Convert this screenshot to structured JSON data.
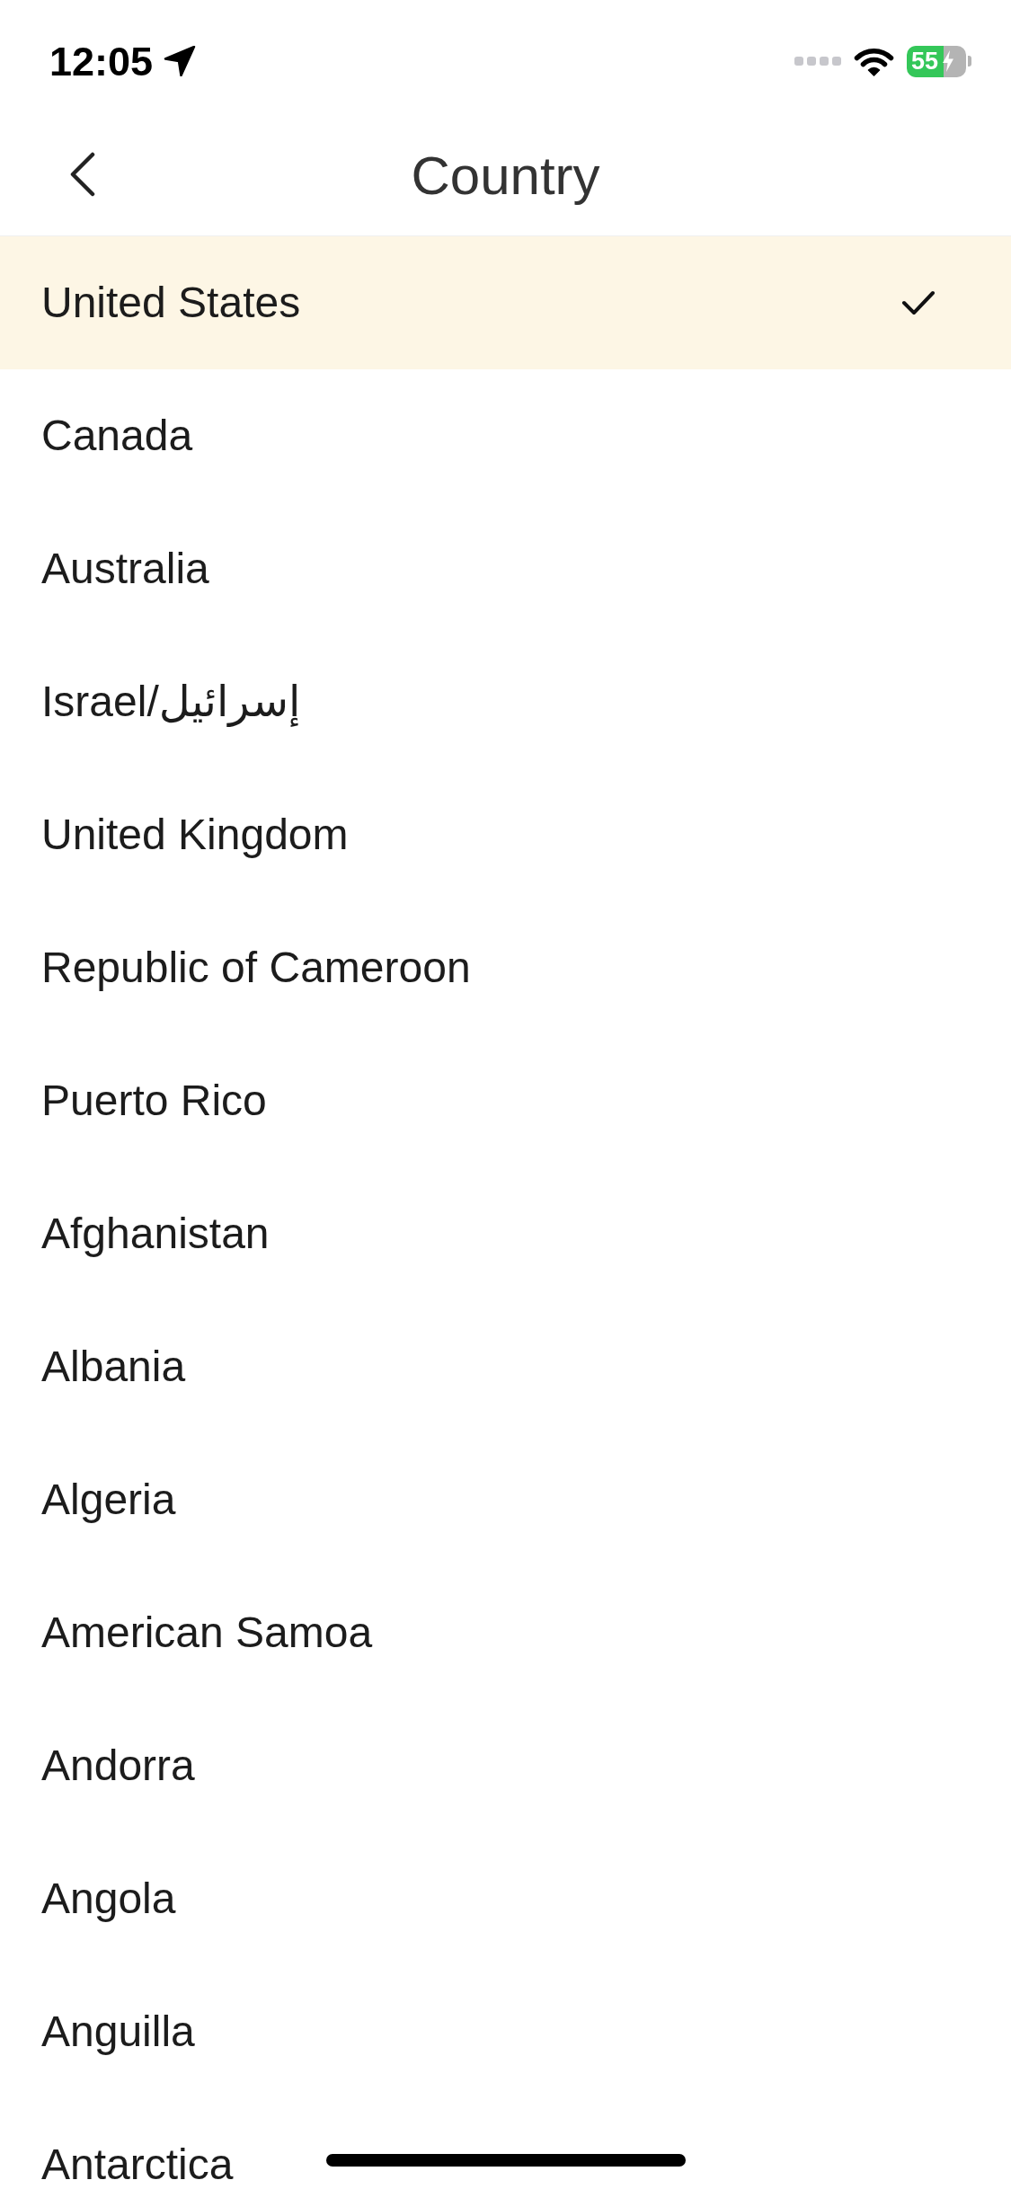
{
  "status_bar": {
    "time": "12:05",
    "battery": "55",
    "charging": true
  },
  "nav": {
    "title": "Country"
  },
  "countries": [
    {
      "name": "United States",
      "selected": true
    },
    {
      "name": "Canada",
      "selected": false
    },
    {
      "name": "Australia",
      "selected": false
    },
    {
      "name": "Israel/إسرائيل",
      "selected": false
    },
    {
      "name": "United Kingdom",
      "selected": false
    },
    {
      "name": "Republic of Cameroon",
      "selected": false
    },
    {
      "name": "Puerto Rico",
      "selected": false
    },
    {
      "name": "Afghanistan",
      "selected": false
    },
    {
      "name": "Albania",
      "selected": false
    },
    {
      "name": "Algeria",
      "selected": false
    },
    {
      "name": "American Samoa",
      "selected": false
    },
    {
      "name": "Andorra",
      "selected": false
    },
    {
      "name": "Angola",
      "selected": false
    },
    {
      "name": "Anguilla",
      "selected": false
    },
    {
      "name": "Antarctica",
      "selected": false
    }
  ]
}
